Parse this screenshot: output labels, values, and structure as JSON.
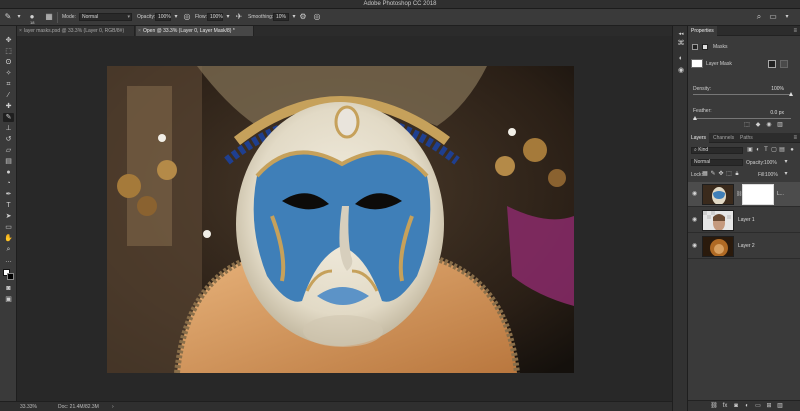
{
  "app": {
    "title": "Adobe Photoshop CC 2018"
  },
  "options_bar": {
    "brush_size": "18",
    "mode_label": "Mode:",
    "mode_value": "Normal",
    "opacity_label": "Opacity:",
    "opacity_value": "100%",
    "flow_label": "Flow:",
    "flow_value": "100%",
    "smoothing_label": "Smoothing:",
    "smoothing_value": "10%"
  },
  "doc_tabs": [
    {
      "label": "layer masks.psd @ 33.3% (Layer 0, RGB/8#)",
      "active": false
    },
    {
      "label": "Open @ 33.3% (Layer 0, Layer Mask/8) *",
      "active": true
    }
  ],
  "properties": {
    "tab_label": "Properties",
    "section_label": "Masks",
    "mask_name": "Layer Mask",
    "density_label": "Density:",
    "density_value": "100%",
    "feather_label": "Feather:",
    "feather_value": "0.0 px"
  },
  "layers": {
    "tabs": [
      {
        "label": "Layers",
        "active": true
      },
      {
        "label": "Channels",
        "active": false
      },
      {
        "label": "Paths",
        "active": false
      }
    ],
    "filter_value": "Kind",
    "blend_mode": "Normal",
    "opacity_label": "Opacity:",
    "opacity_value": "100%",
    "lock_label": "Lock:",
    "fill_label": "Fill:",
    "fill_value": "100%",
    "items": [
      {
        "name": "L...",
        "selected": true
      },
      {
        "name": "Layer 1",
        "selected": false
      },
      {
        "name": "Layer 2",
        "selected": false
      }
    ]
  },
  "status_bar": {
    "zoom": "33.33%",
    "doc_info": "Doc: 21.4M/82.3M"
  },
  "colors": {
    "panel_bg": "#3a3a3a",
    "canvas_bg": "#282828",
    "mask_blue": "#3f7fb8",
    "gold": "#c6a15b"
  }
}
